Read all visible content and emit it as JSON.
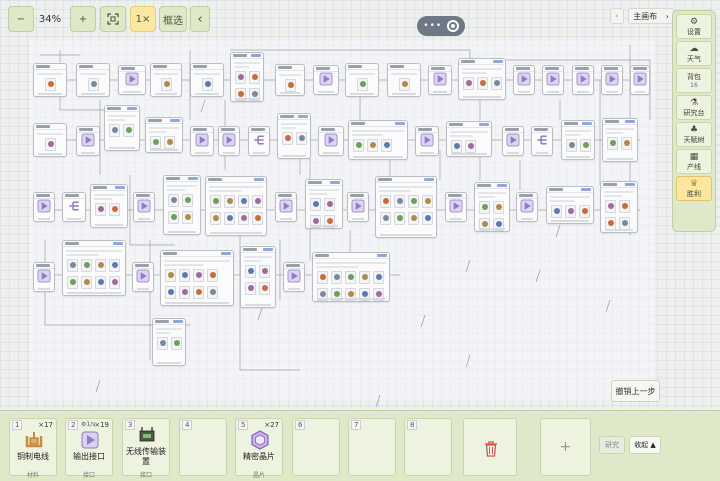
{
  "toolbar": {
    "zoom_out_label": "−",
    "zoom_level": "34%",
    "zoom_in_label": "+",
    "fit_icon": "fit-screen-icon",
    "speed_label": "1×",
    "select_label": "框选",
    "collapse_left_label": "‹"
  },
  "canvas_switch": {
    "back_label": "‹",
    "name": "主画布",
    "arrow": "›"
  },
  "sidebar": {
    "items": [
      {
        "label": "设置",
        "glyph": "⚙"
      },
      {
        "label": "天气",
        "glyph": "☁"
      },
      {
        "label": "背包",
        "sub": "16"
      },
      {
        "label": "研究台",
        "glyph": "⚗"
      },
      {
        "label": "天赋树",
        "glyph": "♣"
      },
      {
        "label": "产线",
        "glyph": "▦"
      },
      {
        "label": "胜利",
        "glyph": "♛"
      }
    ]
  },
  "undo_label": "撤销上一步",
  "hotbar": {
    "slots": [
      {
        "num": "1",
        "count": "×17",
        "name": "铜制电线",
        "cat": "材料",
        "icon": "copper-wire-icon",
        "color": "#c98a3a"
      },
      {
        "num": "2",
        "count": "×19",
        "prefix": "⚙1/s",
        "name": "输出接口",
        "cat": "接口",
        "icon": "output-port-icon",
        "color": "#8e7bc4"
      },
      {
        "num": "3",
        "count": "",
        "name": "无线传输装置",
        "cat": "接口",
        "icon": "wireless-device-icon",
        "color": "#3a4a3a"
      },
      {
        "num": "4",
        "count": "",
        "name": "",
        "cat": ""
      },
      {
        "num": "5",
        "count": "×27",
        "name": "精密晶片",
        "cat": "晶片",
        "icon": "precision-chip-icon",
        "color": "#8a5fc0"
      },
      {
        "num": "6",
        "count": "",
        "name": "",
        "cat": ""
      },
      {
        "num": "7",
        "count": "",
        "name": "",
        "cat": ""
      },
      {
        "num": "8",
        "count": "",
        "name": "",
        "cat": ""
      }
    ],
    "add_label": "+",
    "research_label": "研究",
    "collapse_label": "收起 ▲"
  },
  "colors": {
    "panel": "#dfe8c8",
    "accent": "#fbe7a2",
    "port": "#8e7bc4"
  }
}
